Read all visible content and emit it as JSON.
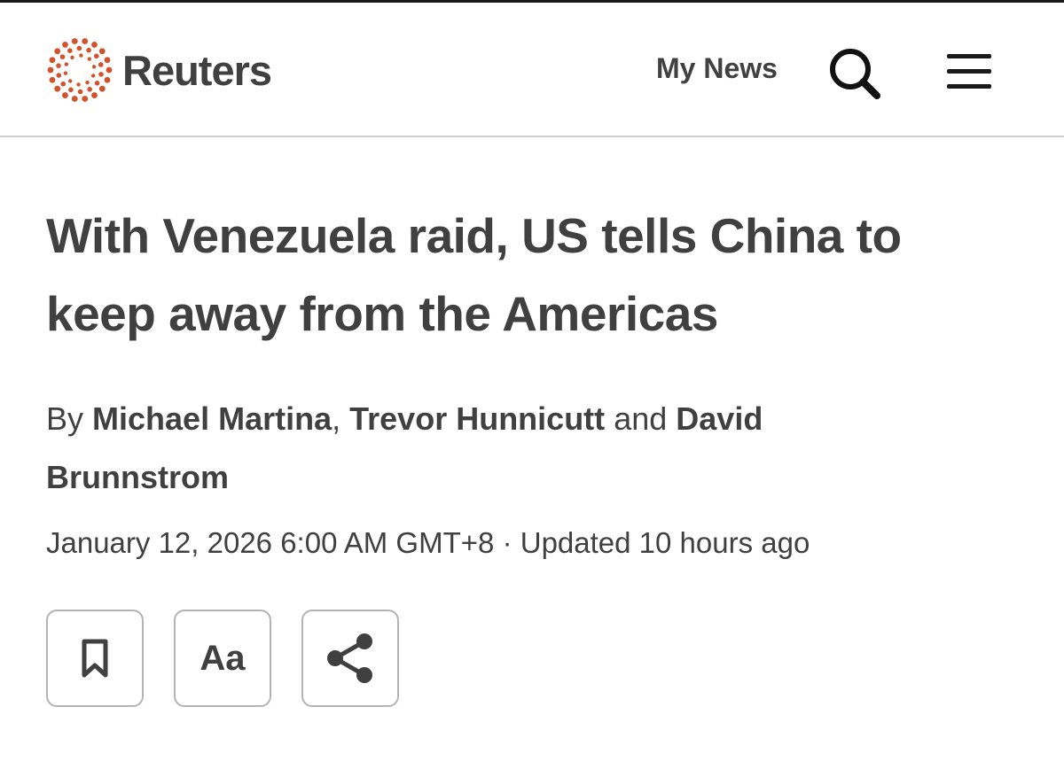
{
  "header": {
    "brand": "Reuters",
    "my_news": "My News",
    "icons": {
      "logo": "reuters-dot-ring-logo",
      "search": "search-icon",
      "menu": "hamburger-menu-icon"
    }
  },
  "article": {
    "headline_line1": "With Venezuela raid, US tells China to",
    "headline_line2": "keep away from the Americas",
    "byline": {
      "prefix": "By",
      "author1": "Michael Martina",
      "separator": ",",
      "author2": "Trevor Hunnicutt",
      "conjunction": "and",
      "author3_part1": "David",
      "author3_part2": "Brunnstrom"
    },
    "date": "January 12, 2026 6:00 AM GMT+8",
    "date_separator": "·",
    "updated": "Updated 10 hours ago"
  },
  "actions": {
    "font_size_label": "Aa",
    "icons": [
      "bookmark-icon",
      "font-size-icon",
      "share-icon"
    ]
  },
  "colors": {
    "text": "#404040",
    "logo_accent": "#d2522b",
    "divider": "#cfcfcf",
    "button_border": "#b3b3b3"
  }
}
